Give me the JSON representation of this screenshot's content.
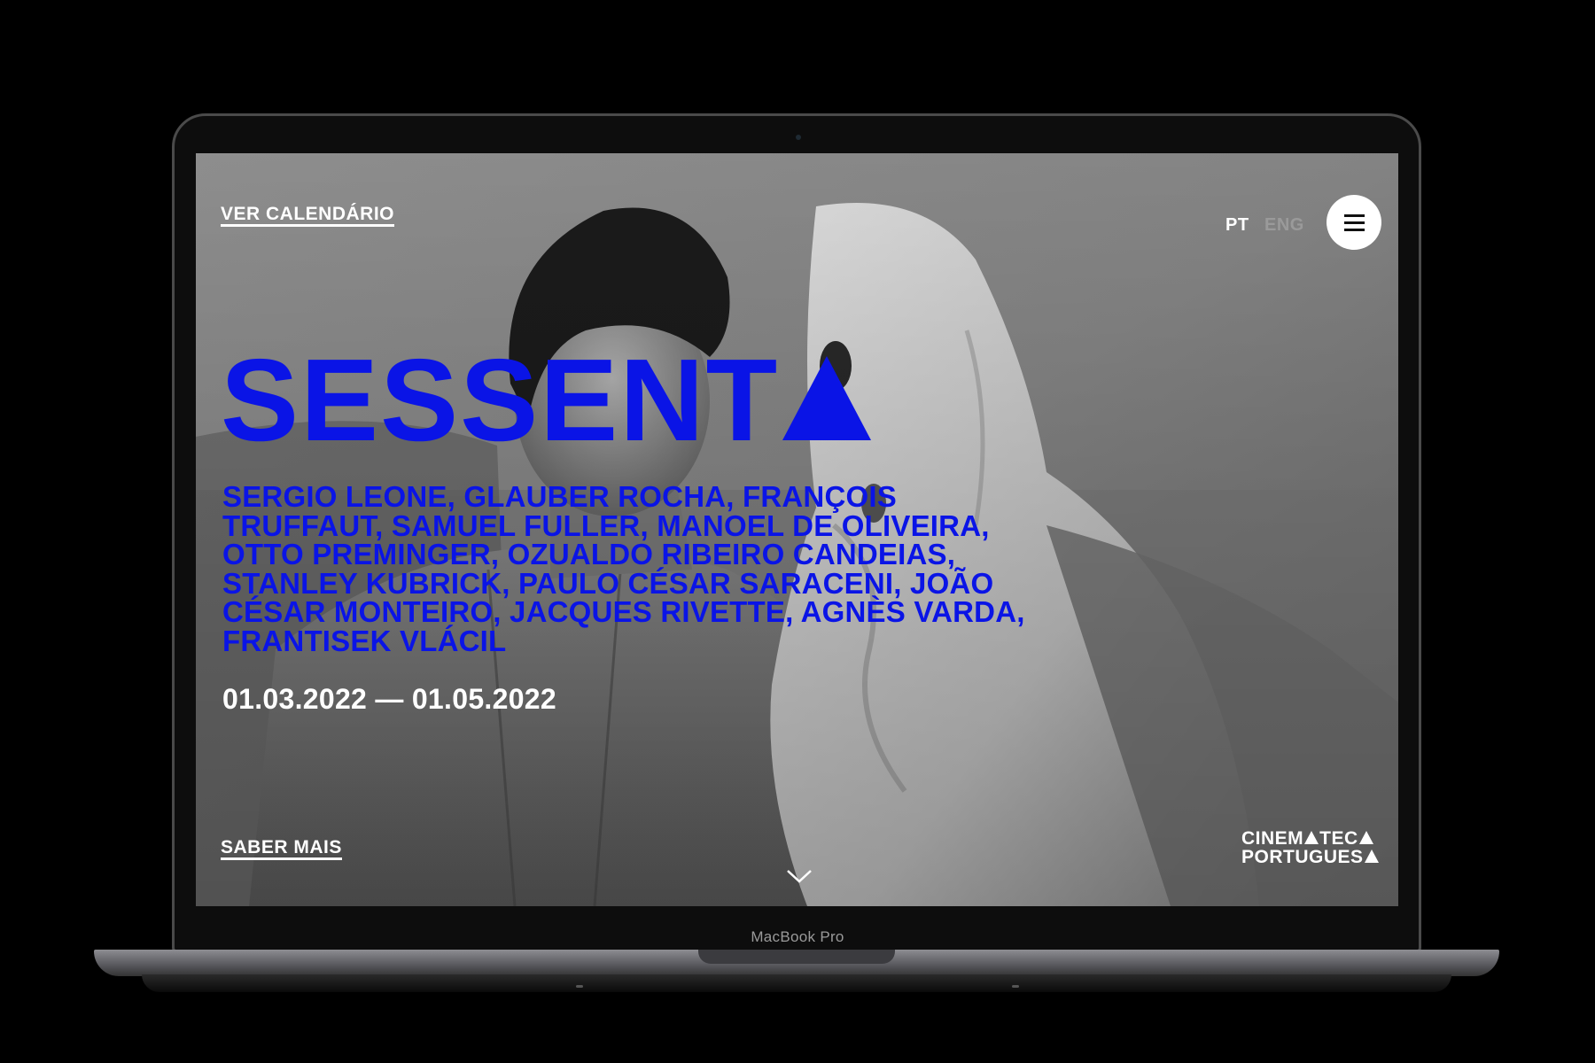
{
  "device": {
    "label": "MacBook Pro"
  },
  "header": {
    "calendar_link": "VER CALENDÁRIO",
    "lang_pt": "PT",
    "lang_eng": "ENG",
    "menu_icon": "hamburger-menu-icon"
  },
  "hero": {
    "title": "SESSENT",
    "names": "SERGIO LEONE, GLAUBER ROCHA, FRANÇOIS TRUFFAUT, SAMUEL FULLER, MANOEL DE OLIVEIRA, OTTO PREMINGER, OZUALDO RIBEIRO CANDEIAS, STANLEY KUBRICK, PAULO CÉSAR SARACENI, JOÃO CÉSAR MONTEIRO, JACQUES RIVETTE, AGNÈS VARDA, FRANTISEK VLÁCIL",
    "dates": "01.03.2022 — 01.05.2022",
    "more_link": "SABER MAIS",
    "scroll_icon": "chevron-down-icon"
  },
  "brand": {
    "line1": "CINEM",
    "line1b": "TEC",
    "line2": "PORTUGUES"
  },
  "colors": {
    "accent": "#0a14e6",
    "text": "#ffffff"
  }
}
